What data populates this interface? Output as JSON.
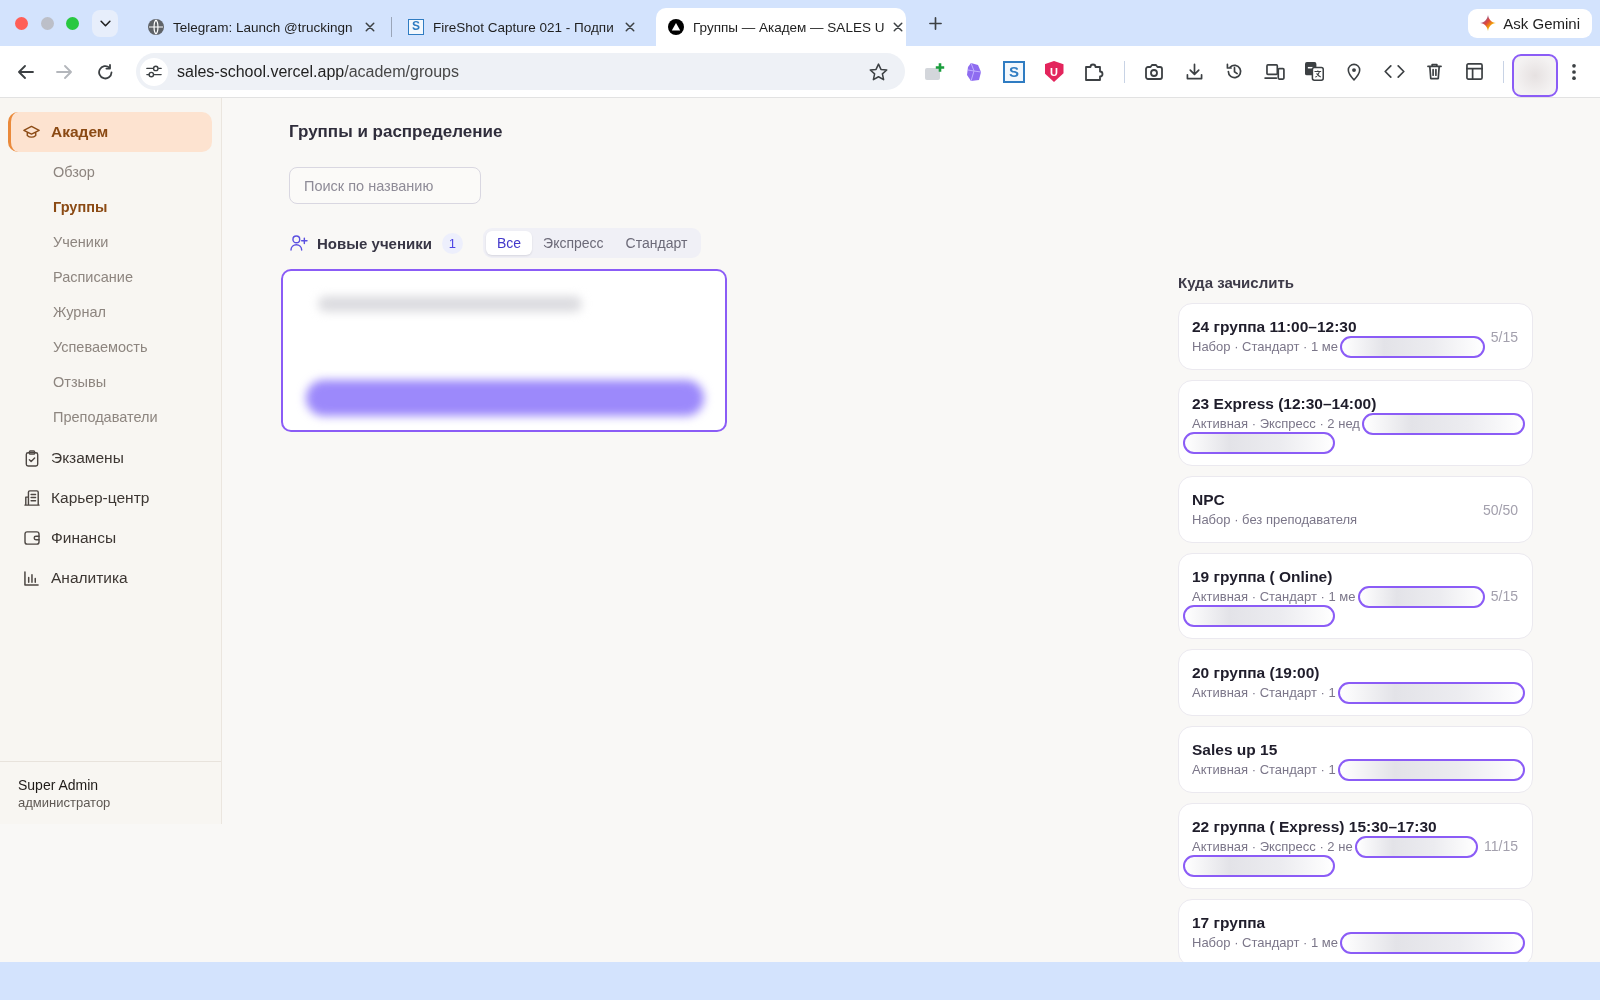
{
  "browser": {
    "window_controls": [
      {
        "kind": "close",
        "disabled": false
      },
      {
        "kind": "minimize",
        "disabled": true
      },
      {
        "kind": "zoom",
        "disabled": false
      }
    ],
    "tabs": [
      {
        "title": "Telegram: Launch @truckingn",
        "selected": false
      },
      {
        "title": "FireShot Capture 021 - Подпи",
        "favicon_text": "S",
        "selected": false
      },
      {
        "title": "Группы — Академ — SALES U",
        "selected": true
      }
    ],
    "gemini_button": "Ask Gemini",
    "nav_buttons": [
      {
        "kind": "back",
        "disabled": false
      },
      {
        "kind": "forward",
        "disabled": true
      },
      {
        "kind": "reload",
        "disabled": false
      }
    ],
    "address": {
      "host": "sales-school.vercel.app",
      "path": "/academ/groups"
    },
    "extensions": [
      {
        "kind": "puzzle-plus"
      },
      {
        "kind": "gem"
      },
      {
        "kind": "letter",
        "text": "S"
      },
      {
        "kind": "shield",
        "text": "U"
      },
      {
        "kind": "puzzle"
      }
    ]
  },
  "sidebar": {
    "items": [
      {
        "label": "Академ",
        "selected": true,
        "children": [
          {
            "label": "Обзор",
            "selected": false
          },
          {
            "label": "Группы",
            "selected": true
          },
          {
            "label": "Ученики",
            "selected": false
          },
          {
            "label": "Расписание",
            "selected": false
          },
          {
            "label": "Журнал",
            "selected": false
          },
          {
            "label": "Успеваемость",
            "selected": false
          },
          {
            "label": "Отзывы",
            "selected": false
          },
          {
            "label": "Преподаватели",
            "selected": false
          }
        ]
      },
      {
        "label": "Экзамены",
        "selected": false
      },
      {
        "label": "Карьер-центр",
        "selected": false
      },
      {
        "label": "Финансы",
        "selected": false
      },
      {
        "label": "Аналитика",
        "selected": false
      }
    ],
    "user": {
      "name": "Super Admin",
      "role": "администратор"
    }
  },
  "page": {
    "title": "Группы и распределение",
    "search": {
      "placeholder": "Поиск по названию"
    },
    "new_students": {
      "title": "Новые ученики",
      "count": "1",
      "filters": [
        {
          "label": "Все",
          "selected": true
        },
        {
          "label": "Экспресс",
          "selected": false
        },
        {
          "label": "Стандарт",
          "selected": false
        }
      ],
      "cards": [
        {
          "kind": "redacted"
        }
      ]
    },
    "enroll": {
      "title": "Куда зачислить",
      "groups": [
        {
          "name": "24 группа 11:00–12:30",
          "meta": "Набор · Стандарт · 1 ме",
          "meta_covered": true,
          "second_line_covered": false,
          "count": "5/15"
        },
        {
          "name": "23 Express (12:30–14:00)",
          "meta": "Активная · Экспресс · 2 нед",
          "meta_covered": true,
          "second_line_covered": true
        },
        {
          "name": "NPC",
          "meta": "Набор · без преподавателя",
          "meta_covered": false,
          "second_line_covered": false,
          "count": "50/50"
        },
        {
          "name": "19 группа ( Online)",
          "meta": "Активная · Стандарт · 1 ме",
          "meta_covered": true,
          "second_line_covered": true,
          "count": "5/15"
        },
        {
          "name": "20 группа (19:00)",
          "meta": "Активная · Стандарт · 1",
          "meta_covered": true,
          "second_line_covered": false
        },
        {
          "name": "Sales up 15",
          "meta": "Активная · Стандарт · 1",
          "meta_covered": true,
          "second_line_covered": false
        },
        {
          "name": "22 группа ( Express) 15:30–17:30",
          "meta": "Активная · Экспресс · 2 не",
          "meta_covered": true,
          "second_line_covered": true,
          "count": "11/15"
        },
        {
          "name": "17 группа",
          "meta": "Набор · Стандарт · 1 ме",
          "meta_covered": true,
          "second_line_covered": false
        }
      ]
    }
  }
}
